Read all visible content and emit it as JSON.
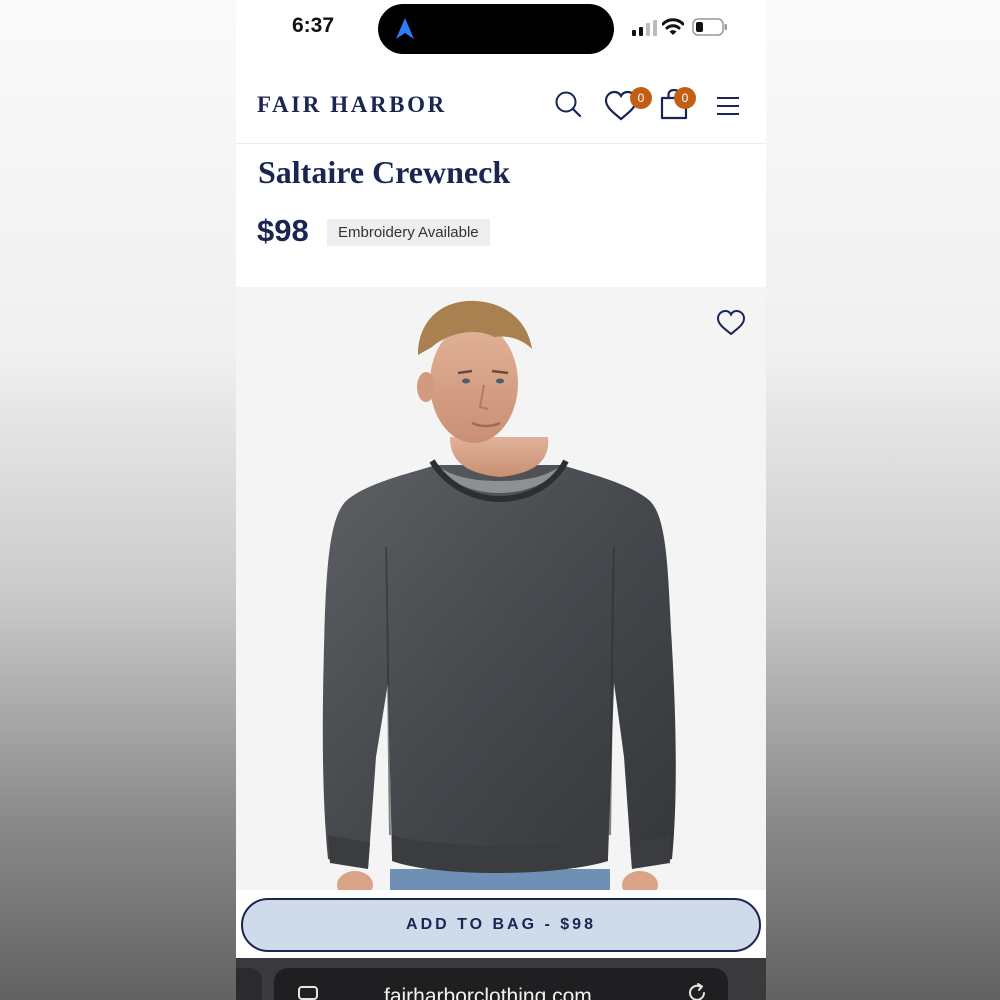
{
  "status_bar": {
    "time": "6:37"
  },
  "header": {
    "logo": "FAIR HARBOR",
    "wishlist_count": "0",
    "bag_count": "0",
    "icons": [
      "search-icon",
      "heart-icon",
      "shopping-bag-icon",
      "hamburger-menu-icon"
    ]
  },
  "product": {
    "title": "Saltaire Crewneck",
    "price": "$98",
    "tag": "Embroidery Available",
    "image_alt": "Man wearing charcoal washed crewneck sweatshirt"
  },
  "cta": {
    "label": "ADD TO BAG - $98"
  },
  "browser": {
    "url": "fairharborclothing.com"
  },
  "colors": {
    "brand_navy": "#1b2552",
    "badge_orange": "#c25e16",
    "cta_background": "#cfdbeb",
    "image_background": "#f4f4f4"
  }
}
